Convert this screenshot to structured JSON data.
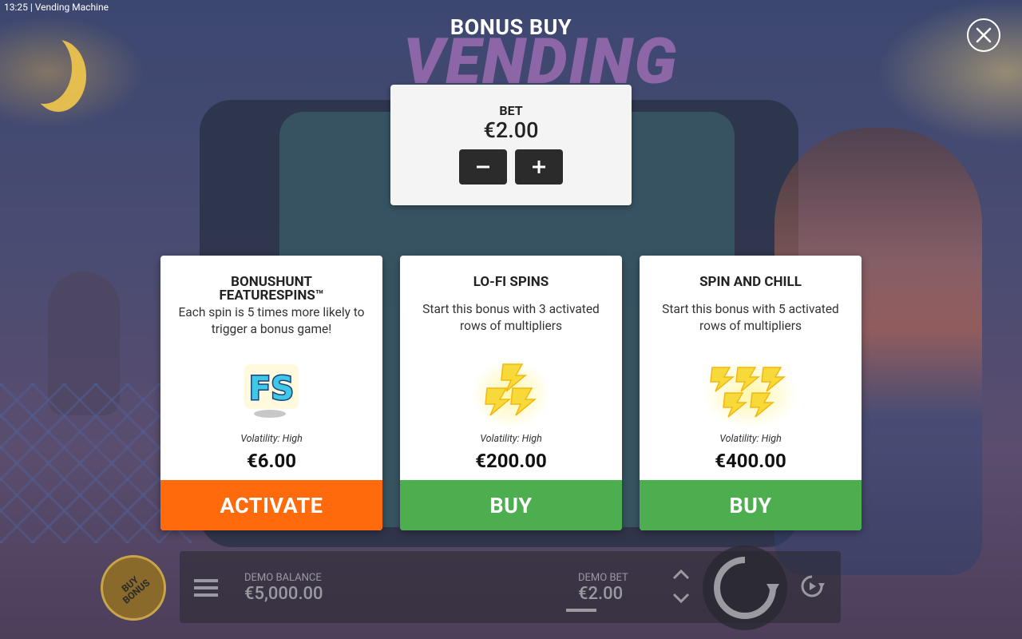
{
  "status_bar": {
    "time_app": "13:25  |  Vending Machine"
  },
  "modal": {
    "title": "BONUS BUY"
  },
  "bet": {
    "label": "BET",
    "value": "€2.00"
  },
  "cards": [
    {
      "title_line1": "BONUSHUNT",
      "title_line2": "FEATURESPINS™",
      "description": "Each spin is 5 times more likely to trigger a bonus game!",
      "volatility": "Volatility: High",
      "price": "€6.00",
      "button_label": "ACTIVATE",
      "button_color": "#ff6a0d",
      "icon": "fs-icon"
    },
    {
      "title": "LO-FI SPINS",
      "description": "Start this bonus with 3 activated rows of multipliers",
      "volatility": "Volatility: High",
      "price": "€200.00",
      "button_label": "BUY",
      "button_color": "#4cae4f",
      "icon": "three-lightning-icon"
    },
    {
      "title": "SPIN AND CHILL",
      "description": "Start this bonus with 5 activated rows of multipliers",
      "volatility": "Volatility: High",
      "price": "€400.00",
      "button_label": "BUY",
      "button_color": "#4cae4f",
      "icon": "five-lightning-icon"
    }
  ],
  "bottom_bar": {
    "buy_bonus_label": "BUY\nBONUS",
    "demo_balance_label": "DEMO BALANCE",
    "demo_balance_value": "€5,000.00",
    "demo_bet_label": "DEMO BET",
    "demo_bet_value": "€2.00"
  },
  "background": {
    "logo_text": "VENDING"
  }
}
